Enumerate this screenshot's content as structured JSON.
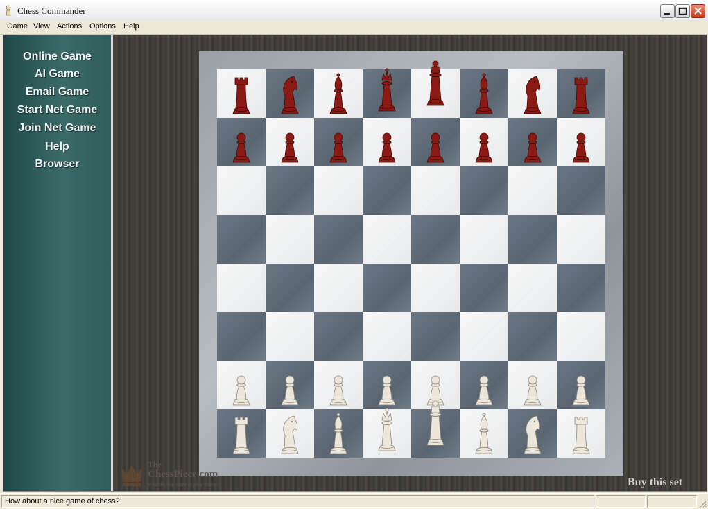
{
  "window": {
    "title": "Chess Commander"
  },
  "menu": {
    "items": [
      "Game",
      "View",
      "Actions",
      "Options",
      "Help"
    ]
  },
  "sidebar": {
    "links": [
      "Online Game",
      "AI Game",
      "Email Game",
      "Start Net Game",
      "Join Net Game",
      "Help",
      "Browser"
    ]
  },
  "board": {
    "ranks": [
      [
        "rook",
        "knight",
        "bishop",
        "queen",
        "king",
        "bishop",
        "knight",
        "rook"
      ],
      [
        "pawn",
        "pawn",
        "pawn",
        "pawn",
        "pawn",
        "pawn",
        "pawn",
        "pawn"
      ],
      [
        null,
        null,
        null,
        null,
        null,
        null,
        null,
        null
      ],
      [
        null,
        null,
        null,
        null,
        null,
        null,
        null,
        null
      ],
      [
        null,
        null,
        null,
        null,
        null,
        null,
        null,
        null
      ],
      [
        null,
        null,
        null,
        null,
        null,
        null,
        null,
        null
      ],
      [
        "pawn",
        "pawn",
        "pawn",
        "pawn",
        "pawn",
        "pawn",
        "pawn",
        "pawn"
      ],
      [
        "rook",
        "knight",
        "bishop",
        "queen",
        "king",
        "bishop",
        "knight",
        "rook"
      ]
    ],
    "top_color": "dark-red",
    "bottom_color": "ivory",
    "colors": {
      "red_piece": "#8b1a14",
      "ivory_piece": "#ece7da",
      "dark_square": "#5f6b78",
      "light_square": "#f2f2f2"
    }
  },
  "branding": {
    "the": "The",
    "name": "ChessPiece.com",
    "tagline": "Who do You want to play today?",
    "buy": "Buy this set"
  },
  "status": {
    "message": "How about a nice game of chess?"
  }
}
